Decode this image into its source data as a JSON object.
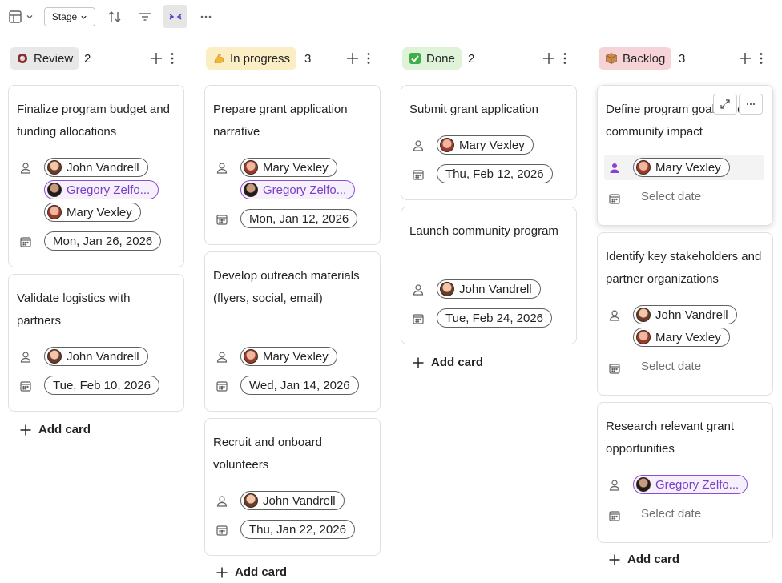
{
  "toolbar": {
    "stage_label": "Stage"
  },
  "columns": [
    {
      "label": "Review",
      "count": "2",
      "emoji": "red-ring-icon",
      "pill_color": "#e8e8e8",
      "cards": [
        {
          "title": "Finalize program budget and funding allocations",
          "assignees": [
            "John Vandrell",
            "Gregory Zelfo...",
            "Mary Vexley"
          ],
          "date": "Mon, Jan 26, 2026"
        },
        {
          "title": "Validate logistics with partners",
          "assignees": [
            "John Vandrell"
          ],
          "date": "Tue, Feb 10, 2026"
        }
      ],
      "add_card": "Add card"
    },
    {
      "label": "In progress",
      "count": "3",
      "emoji": "flexed-arm-icon",
      "pill_color": "#fbeec5",
      "cards": [
        {
          "title": "Prepare grant application narrative",
          "assignees": [
            "Mary Vexley",
            "Gregory Zelfo..."
          ],
          "date": "Mon, Jan 12, 2026"
        },
        {
          "title": "Develop outreach materials (flyers, social, email)",
          "assignees": [
            "Mary Vexley"
          ],
          "date": "Wed, Jan 14, 2026"
        },
        {
          "title": "Recruit and onboard volunteers",
          "assignees": [
            "John Vandrell"
          ],
          "date": "Thu, Jan 22, 2026"
        }
      ],
      "add_card": "Add card"
    },
    {
      "label": "Done",
      "count": "2",
      "emoji": "check-box-icon",
      "pill_color": "#dff3d9",
      "cards": [
        {
          "title": "Submit grant application",
          "assignees": [
            "Mary Vexley"
          ],
          "date": "Thu, Feb 12, 2026"
        },
        {
          "title": "Launch community program",
          "assignees": [
            "John Vandrell"
          ],
          "date": "Tue, Feb 24, 2026"
        }
      ],
      "add_card": "Add card"
    },
    {
      "label": "Backlog",
      "count": "3",
      "emoji": "package-icon",
      "pill_color": "#f6d3d6",
      "cards": [
        {
          "title": "Define program goals and community impact",
          "assignees": [
            "Mary Vexley"
          ],
          "date_placeholder": "Select date"
        },
        {
          "title": "Identify key stakeholders and partner organizations",
          "assignees": [
            "John Vandrell",
            "Mary Vexley"
          ],
          "date_placeholder": "Select date"
        },
        {
          "title": "Research relevant grant opportunities",
          "assignees": [
            "Gregory Zelfo..."
          ],
          "date_placeholder": "Select date"
        }
      ],
      "add_card": "Add card"
    }
  ]
}
